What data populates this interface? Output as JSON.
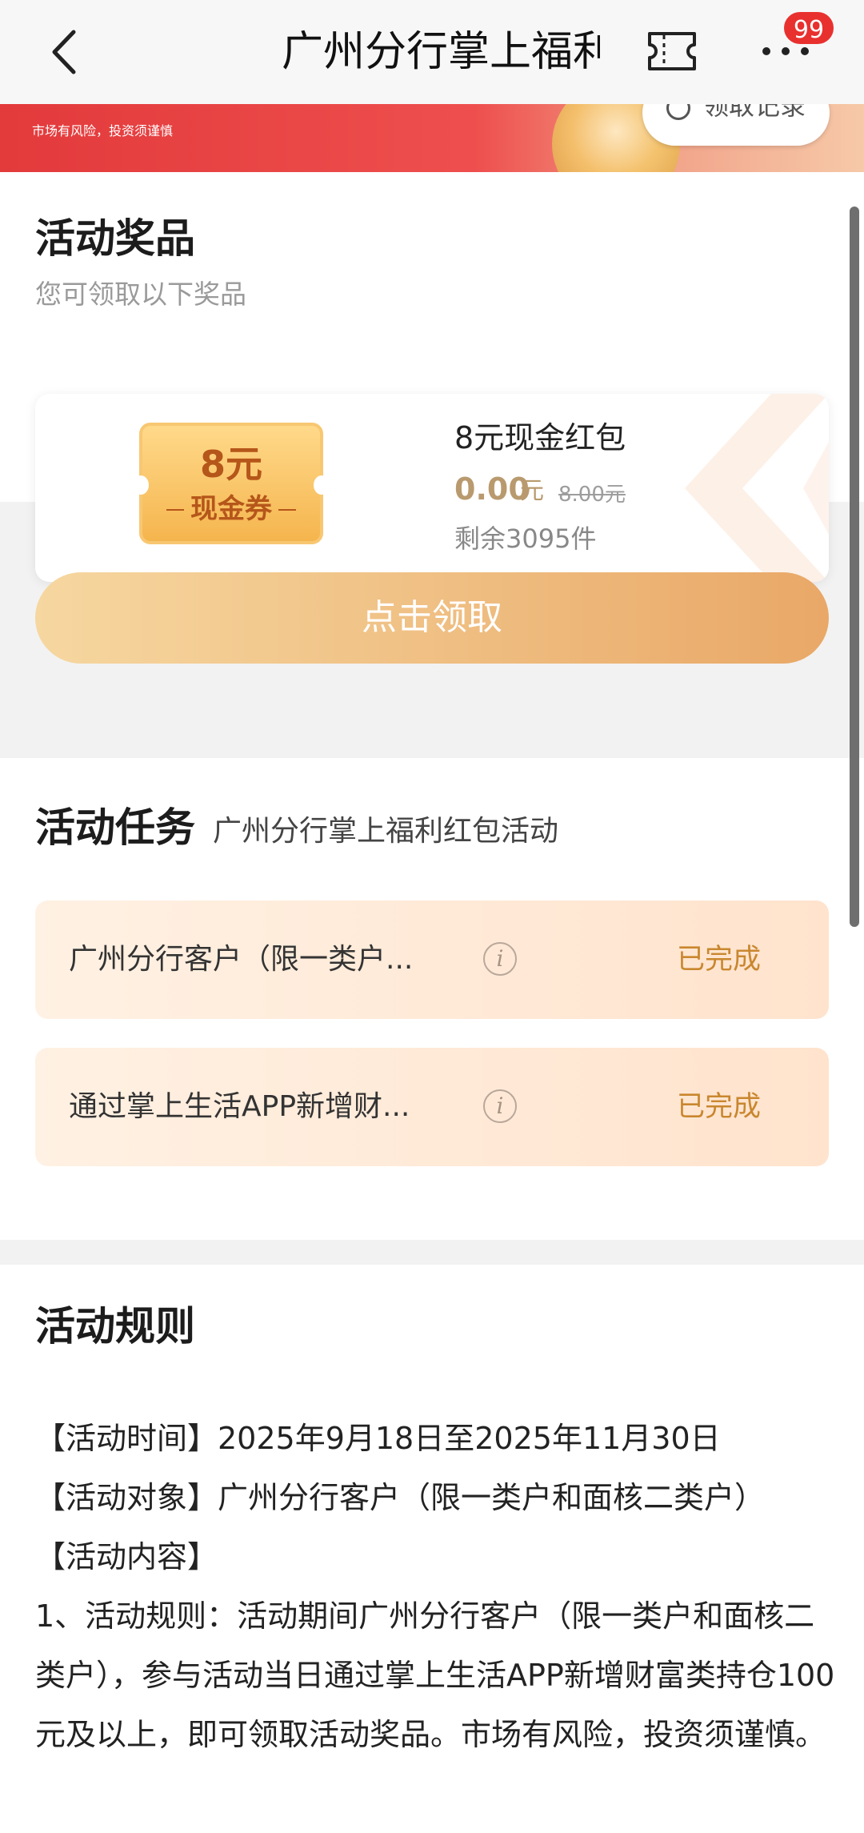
{
  "nav": {
    "title": "广州分行掌上福利红包活动",
    "badge_count": "99",
    "icons": [
      "chevron-left-icon",
      "ticket-icon",
      "more-icon"
    ]
  },
  "banner": {
    "risk_text": "市场有风险，投资须谨慎",
    "records_label": "领取记录"
  },
  "prizes": {
    "title": "活动奖品",
    "subtitle": "您可领取以下奖品",
    "item": {
      "coupon_amount": "8元",
      "coupon_caption": "现金券",
      "name": "8元现金红包",
      "price": "0.00",
      "price_unit": "元",
      "original_price": "8.00元",
      "stock": "剩余3095件"
    },
    "claim_label": "点击领取"
  },
  "tasks": {
    "title": "活动任务",
    "subtitle": "广州分行掌上福利红包活动",
    "items": [
      {
        "name": "广州分行客户（限一类户...",
        "status": "已完成"
      },
      {
        "name": "通过掌上生活APP新增财...",
        "status": "已完成"
      }
    ]
  },
  "rules": {
    "title": "活动规则",
    "time": "【活动时间】2025年9月18日至2025年11月30日",
    "target": "【活动对象】广州分行客户（限一类户和面核二类户）",
    "content_heading": "【活动内容】",
    "paragraph": "1、活动规则：活动期间广州分行客户（限一类户和面核二类户），参与活动当日通过掌上生活APP新增财富类持仓100元及以上，即可领取活动奖品。市场有风险，投资须谨慎。"
  },
  "colors": {
    "accent": "#e9a867",
    "status_done": "#c9872f",
    "banner_red": "#e33a3c",
    "badge": "#e8312f"
  }
}
